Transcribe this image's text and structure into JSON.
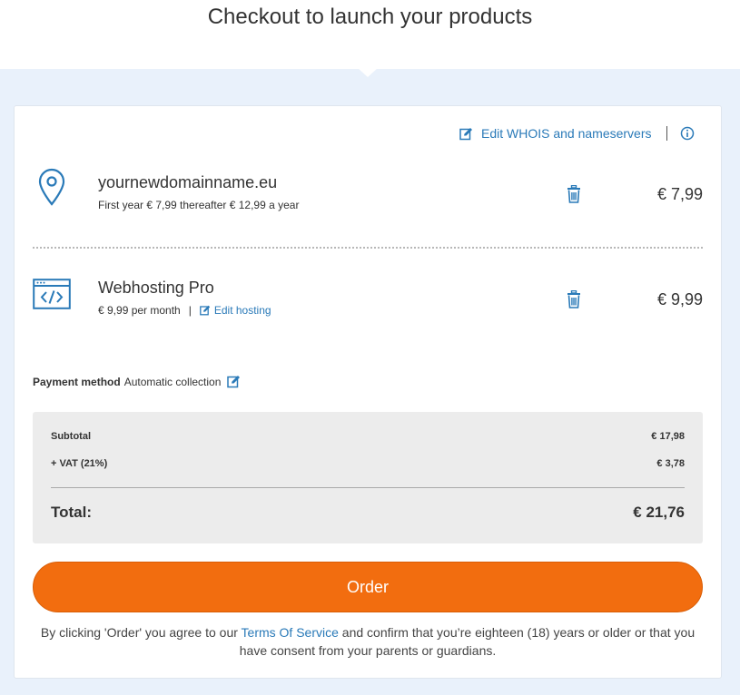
{
  "header": {
    "title": "Checkout to launch your products"
  },
  "card": {
    "whois_link": "Edit WHOIS and nameservers",
    "items": [
      {
        "name": "yournewdomainname.eu",
        "sub": "First year € 7,99 thereafter € 12,99 a year",
        "price": "€ 7,99",
        "icon": "map-pin-icon"
      },
      {
        "name": "Webhosting Pro",
        "sub": "€ 9,99 per month",
        "sep": "|",
        "edit_label": "Edit hosting",
        "price": "€ 9,99",
        "icon": "code-window-icon"
      }
    ],
    "payment": {
      "label": "Payment method",
      "value": "Automatic collection"
    },
    "summary": {
      "subtotal_label": "Subtotal",
      "subtotal_value": "€ 17,98",
      "vat_label": "+ VAT (21%)",
      "vat_value": "€ 3,78",
      "total_label": "Total:",
      "total_value": "€ 21,76"
    },
    "order_button": "Order",
    "terms": {
      "before": "By clicking 'Order' you agree to our ",
      "link": "Terms Of Service",
      "after": " and confirm that you’re eighteen (18) years or older or that you have consent from your parents or guardians."
    }
  },
  "colors": {
    "accent": "#2a7ab8",
    "order_button": "#f26d0f",
    "background_band": "#e9f1fb"
  }
}
